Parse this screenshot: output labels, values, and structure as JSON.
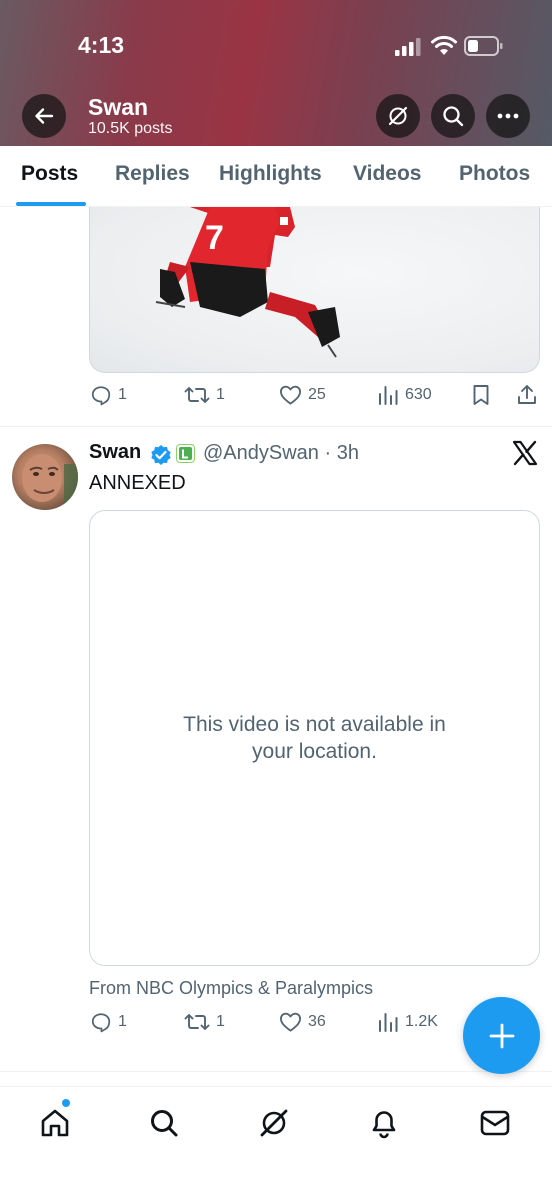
{
  "status_bar": {
    "time": "4:13"
  },
  "header": {
    "title": "Swan",
    "subtitle": "10.5K posts"
  },
  "tabs": [
    {
      "label": "Posts",
      "active": true
    },
    {
      "label": "Replies"
    },
    {
      "label": "Highlights"
    },
    {
      "label": "Videos"
    },
    {
      "label": "Photos"
    }
  ],
  "post1": {
    "replies": "1",
    "reposts": "1",
    "likes": "25",
    "views": "630",
    "jersey_number": "7"
  },
  "post2": {
    "author": "Swan",
    "handle_time": "@AndySwan · 3h",
    "text": "ANNEXED",
    "video_message": "This video is not available in your location.",
    "source": "From NBC Olympics & Paralympics",
    "replies": "1",
    "reposts": "1",
    "likes": "36",
    "views": "1.2K"
  },
  "colors": {
    "accent": "#1d9bf0",
    "muted": "#536471",
    "text": "#0f1419"
  }
}
